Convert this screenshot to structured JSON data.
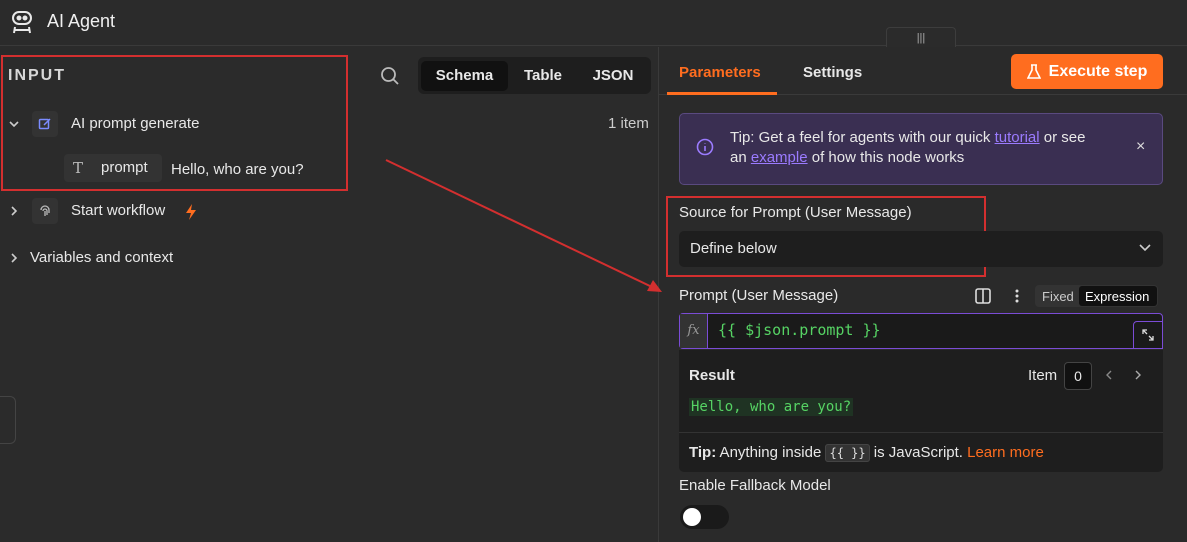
{
  "header": {
    "title": "AI Agent",
    "drag_glyph": "|||"
  },
  "input_panel": {
    "label": "INPUT",
    "view_tabs": [
      "Schema",
      "Table",
      "JSON"
    ],
    "active_view": "Schema",
    "item_count": "1 item",
    "nodes": [
      {
        "label": "AI prompt generate",
        "expanded": true,
        "icon": "edit-icon",
        "fields": [
          {
            "type_glyph": "T",
            "key": "prompt",
            "value": "Hello, who are you?"
          }
        ]
      },
      {
        "label": "Start workflow",
        "expanded": false,
        "icon": "fingerprint-icon",
        "trigger": true
      },
      {
        "label": "Variables and context",
        "expanded": false
      }
    ]
  },
  "params_panel": {
    "tabs": [
      "Parameters",
      "Settings"
    ],
    "active_tab": "Parameters",
    "execute_label": "Execute step",
    "tip": {
      "t1": "Tip: Get a feel for agents with our quick ",
      "link1": "tutorial",
      "t2": " or see",
      "t3": "an ",
      "link2": "example",
      "t4": " of how this node works",
      "close": "×"
    },
    "source_label": "Source for Prompt (User Message)",
    "source_value": "Define below",
    "prompt_label": "Prompt (User Message)",
    "mode_fixed": "Fixed",
    "mode_expression": "Expression",
    "fx": "fx",
    "expression": "{{ $json.prompt }}",
    "result": {
      "label": "Result",
      "item_label": "Item",
      "item_value": "0",
      "value": "Hello, who are you?"
    },
    "tip2": {
      "bold": "Tip:",
      "t1": " Anything inside ",
      "code": "{{ }}",
      "t2": " is JavaScript. ",
      "link": "Learn more"
    },
    "fallback_label": "Enable Fallback Model",
    "fallback_enabled": false
  },
  "colors": {
    "accent": "#ff6d1f",
    "highlight": "#d32f2f",
    "purple": "#7b4cd6"
  }
}
